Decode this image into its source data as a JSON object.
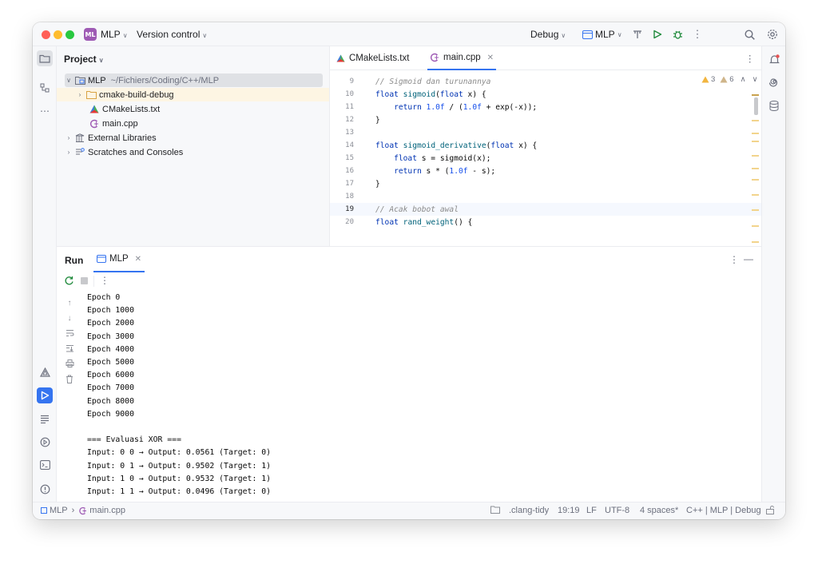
{
  "titlebar": {
    "project_badge": "ML",
    "project_name": "MLP",
    "vcs_label": "Version control",
    "config_label": "Debug",
    "run_target": "MLP"
  },
  "project_panel": {
    "title": "Project",
    "tree": [
      {
        "label": "MLP",
        "path": "~/Fichiers/Coding/C++/MLP"
      },
      {
        "label": "cmake-build-debug"
      },
      {
        "label": "CMakeLists.txt"
      },
      {
        "label": "main.cpp"
      },
      {
        "label": "External Libraries"
      },
      {
        "label": "Scratches and Consoles"
      }
    ]
  },
  "editor": {
    "tabs": [
      {
        "label": "CMakeLists.txt"
      },
      {
        "label": "main.cpp"
      }
    ],
    "warnings": "3",
    "weak_warnings": "6",
    "lines": [
      {
        "n": "9"
      },
      {
        "n": "10"
      },
      {
        "n": "11"
      },
      {
        "n": "12"
      },
      {
        "n": "13"
      },
      {
        "n": "14"
      },
      {
        "n": "15"
      },
      {
        "n": "16"
      },
      {
        "n": "17"
      },
      {
        "n": "18"
      },
      {
        "n": "19"
      },
      {
        "n": "20"
      }
    ],
    "code": {
      "l9": "// Sigmoid dan turunannya",
      "l10a": "float",
      "l10b": "sigmoid",
      "l10c": "(",
      "l10d": "float",
      "l10e": " x) {",
      "l11a": "    return ",
      "l11b": "1.0f",
      "l11c": " / (",
      "l11d": "1.0f",
      "l11e": " + exp(-x));",
      "l12": "}",
      "l14a": "float",
      "l14b": "sigmoid_derivative",
      "l14c": "(",
      "l14d": "float",
      "l14e": " x) {",
      "l15a": "    float",
      "l15b": " s = sigmoid(x);",
      "l16a": "    return",
      "l16b": " s * (",
      "l16c": "1.0f",
      "l16d": " - s);",
      "l17": "}",
      "l19": "// Acak bobot awal",
      "l20a": "float",
      "l20b": "rand_weight",
      "l20c": "() {"
    }
  },
  "run_panel": {
    "title": "Run",
    "tab_label": "MLP",
    "output": [
      "Epoch 0",
      "Epoch 1000",
      "Epoch 2000",
      "Epoch 3000",
      "Epoch 4000",
      "Epoch 5000",
      "Epoch 6000",
      "Epoch 7000",
      "Epoch 8000",
      "Epoch 9000",
      "",
      "=== Evaluasi XOR ===",
      "Input: 0 0 → Output: 0.0561 (Target: 0)",
      "Input: 0 1 → Output: 0.9502 (Target: 1)",
      "Input: 1 0 → Output: 0.9532 (Target: 1)",
      "Input: 1 1 → Output: 0.0496 (Target: 0)"
    ]
  },
  "statusbar": {
    "crumb_project": "MLP",
    "crumb_file": "main.cpp",
    "linter": ".clang-tidy",
    "position": "19:19",
    "line_ending": "LF",
    "encoding": "UTF-8",
    "indent": "4 spaces*",
    "context": "C++ | MLP | Debug"
  }
}
